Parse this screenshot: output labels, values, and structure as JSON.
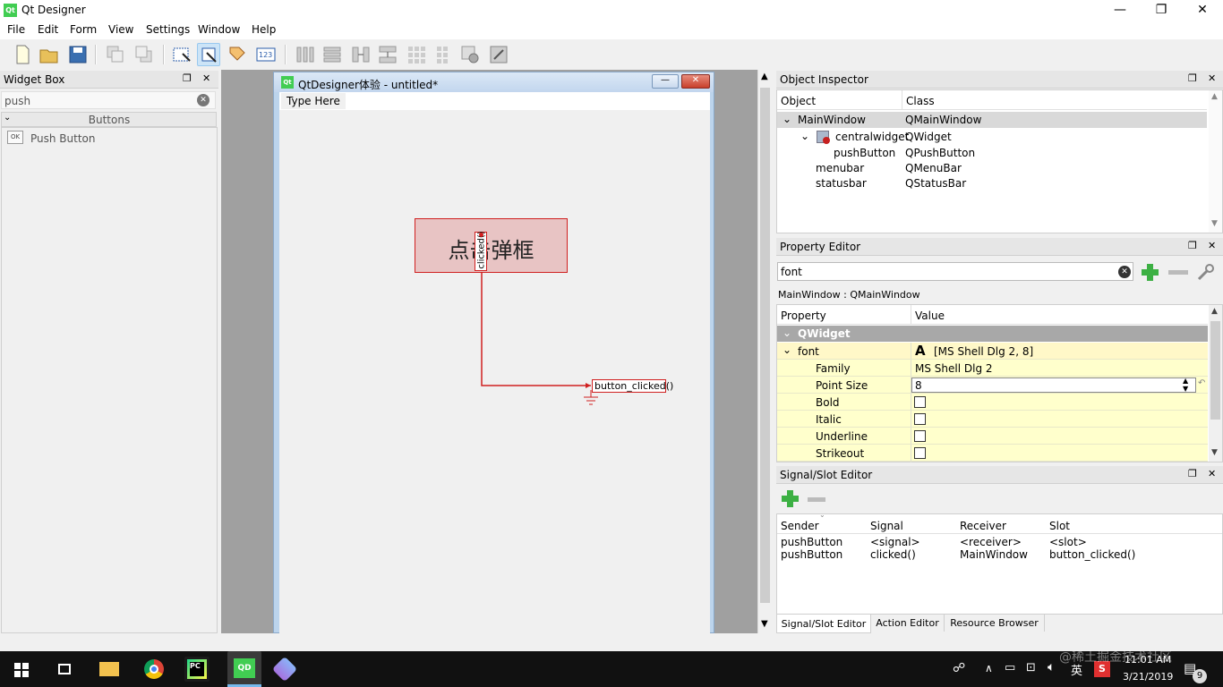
{
  "window": {
    "title": "Qt Designer",
    "app_icon": "Qt"
  },
  "window_controls": {
    "minimize": "—",
    "restore": "❐",
    "close": "✕"
  },
  "menu": [
    "File",
    "Edit",
    "Form",
    "View",
    "Settings",
    "Window",
    "Help"
  ],
  "toolbar_icons": [
    "new-icon",
    "open-icon",
    "save-icon",
    "bring-to-front-icon",
    "send-to-back-icon",
    "edit-widgets-icon",
    "edit-signals-slots-icon",
    "edit-buddies-icon",
    "edit-tab-order-icon",
    "layout-horizontal-icon",
    "layout-vertical-icon",
    "layout-horizontal-splitter-icon",
    "layout-vertical-splitter-icon",
    "layout-grid-icon",
    "layout-form-icon",
    "break-layout-icon",
    "adjust-size-icon"
  ],
  "widget_box": {
    "title": "Widget Box",
    "search_value": "push",
    "category": "Buttons",
    "items": [
      {
        "icon_text": "OK",
        "label": "Push Button"
      }
    ]
  },
  "form": {
    "title": "QtDesigner体验 - untitled*",
    "type_here": "Type Here",
    "button_text": "点击弹框",
    "signal_label": "clicked()",
    "slot_label": "button_clicked()"
  },
  "object_inspector": {
    "title": "Object Inspector",
    "headers": [
      "Object",
      "Class"
    ],
    "rows": [
      {
        "object": "MainWindow",
        "class": "QMainWindow"
      },
      {
        "object": "centralwidget",
        "class": "QWidget"
      },
      {
        "object": "pushButton",
        "class": "QPushButton"
      },
      {
        "object": "menubar",
        "class": "QMenuBar"
      },
      {
        "object": "statusbar",
        "class": "QStatusBar"
      }
    ]
  },
  "property_editor": {
    "title": "Property Editor",
    "filter_value": "font",
    "context": "MainWindow : QMainWindow",
    "headers": [
      "Property",
      "Value"
    ],
    "group": "QWidget",
    "font_row": {
      "name": "font",
      "value": "[MS Shell Dlg 2, 8]",
      "icon": "A"
    },
    "rows": [
      {
        "name": "Family",
        "value": "MS Shell Dlg 2"
      },
      {
        "name": "Point Size",
        "value": "8"
      },
      {
        "name": "Bold",
        "value": ""
      },
      {
        "name": "Italic",
        "value": ""
      },
      {
        "name": "Underline",
        "value": ""
      },
      {
        "name": "Strikeout",
        "value": ""
      }
    ]
  },
  "signal_slot_editor": {
    "title": "Signal/Slot Editor",
    "headers": [
      "Sender",
      "Signal",
      "Receiver",
      "Slot"
    ],
    "rows": [
      {
        "sender": "pushButton",
        "signal": "<signal>",
        "receiver": "<receiver>",
        "slot": "<slot>"
      },
      {
        "sender": "pushButton",
        "signal": "clicked()",
        "receiver": "MainWindow",
        "slot": "button_clicked()"
      }
    ]
  },
  "bottom_tabs": [
    "Signal/Slot Editor",
    "Action Editor",
    "Resource Browser"
  ],
  "taskbar": {
    "apps": [
      "start-icon",
      "task-view-icon",
      "file-explorer-icon",
      "chrome-icon",
      "pycharm-icon",
      "qt-designer-icon",
      "app-icon"
    ],
    "tray_ime": "英",
    "time": "11:01 AM",
    "date": "3/21/2019",
    "notifications": "9",
    "watermark": "@稀土掘金技术社区"
  },
  "colors": {
    "accent": "#cce4f7",
    "selection_red": "#d02020",
    "property_yellow": "#ffffcc"
  }
}
